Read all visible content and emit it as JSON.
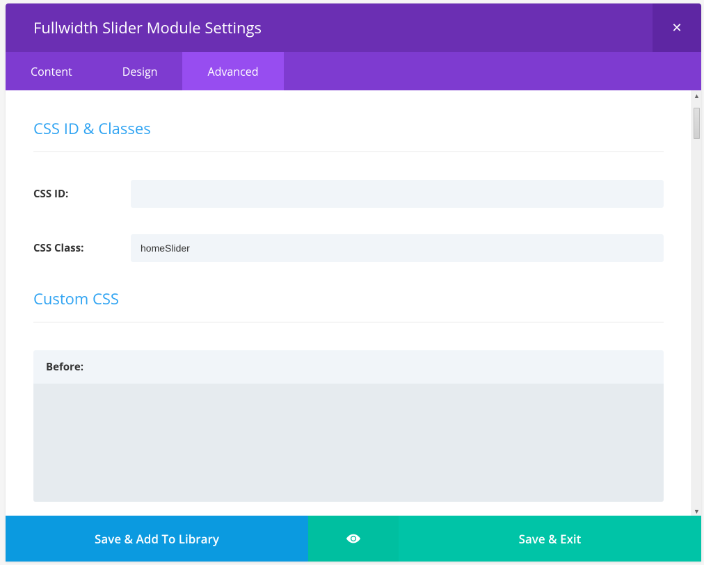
{
  "header": {
    "title": "Fullwidth Slider Module Settings"
  },
  "tabs": {
    "content": "Content",
    "design": "Design",
    "advanced": "Advanced"
  },
  "sections": {
    "css_id_classes": {
      "heading": "CSS ID & Classes",
      "css_id_label": "CSS ID:",
      "css_id_value": "",
      "css_class_label": "CSS Class:",
      "css_class_value": "homeSlider"
    },
    "custom_css": {
      "heading": "Custom CSS",
      "before_label": "Before:",
      "before_value": ""
    }
  },
  "footer": {
    "save_library": "Save & Add To Library",
    "save_exit": "Save & Exit"
  }
}
